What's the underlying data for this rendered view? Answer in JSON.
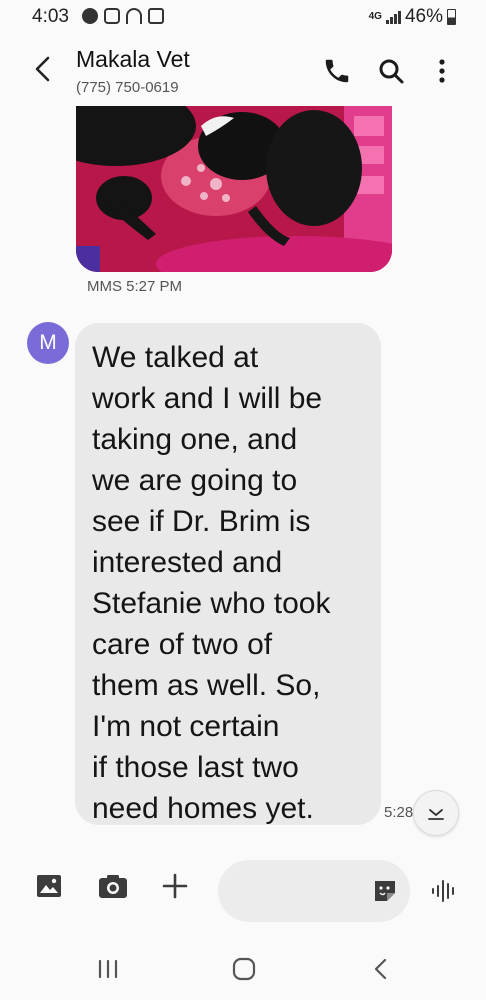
{
  "status": {
    "time": "4:03",
    "network": "4G",
    "battery": "46%",
    "battery_level": 0.46
  },
  "header": {
    "name": "Makala Vet",
    "number": "(775) 750-0619"
  },
  "mms": {
    "time": "MMS 5:27 PM"
  },
  "message": {
    "avatar_letter": "M",
    "text": "We talked at\nwork and I will be\ntaking one, and\nwe are going to\nsee if Dr. Brim is\ninterested and\nStefanie who took\ncare of two of\nthem as well. So,\nI'm not certain\nif those last two\nneed homes yet.",
    "time": "5:28"
  },
  "composer": {
    "placeholder": ""
  },
  "colors": {
    "avatar": "#7a6cd8",
    "bubble": "#e9e9e9",
    "background": "#fafafa"
  },
  "icons": {
    "back": "chevron-left-icon",
    "call": "phone-icon",
    "search": "search-icon",
    "more": "more-vertical-icon",
    "gallery": "image-icon",
    "camera": "camera-icon",
    "add": "plus-icon",
    "sticker": "sticker-icon",
    "voice": "voice-icon",
    "scroll": "chevron-down-icon"
  }
}
